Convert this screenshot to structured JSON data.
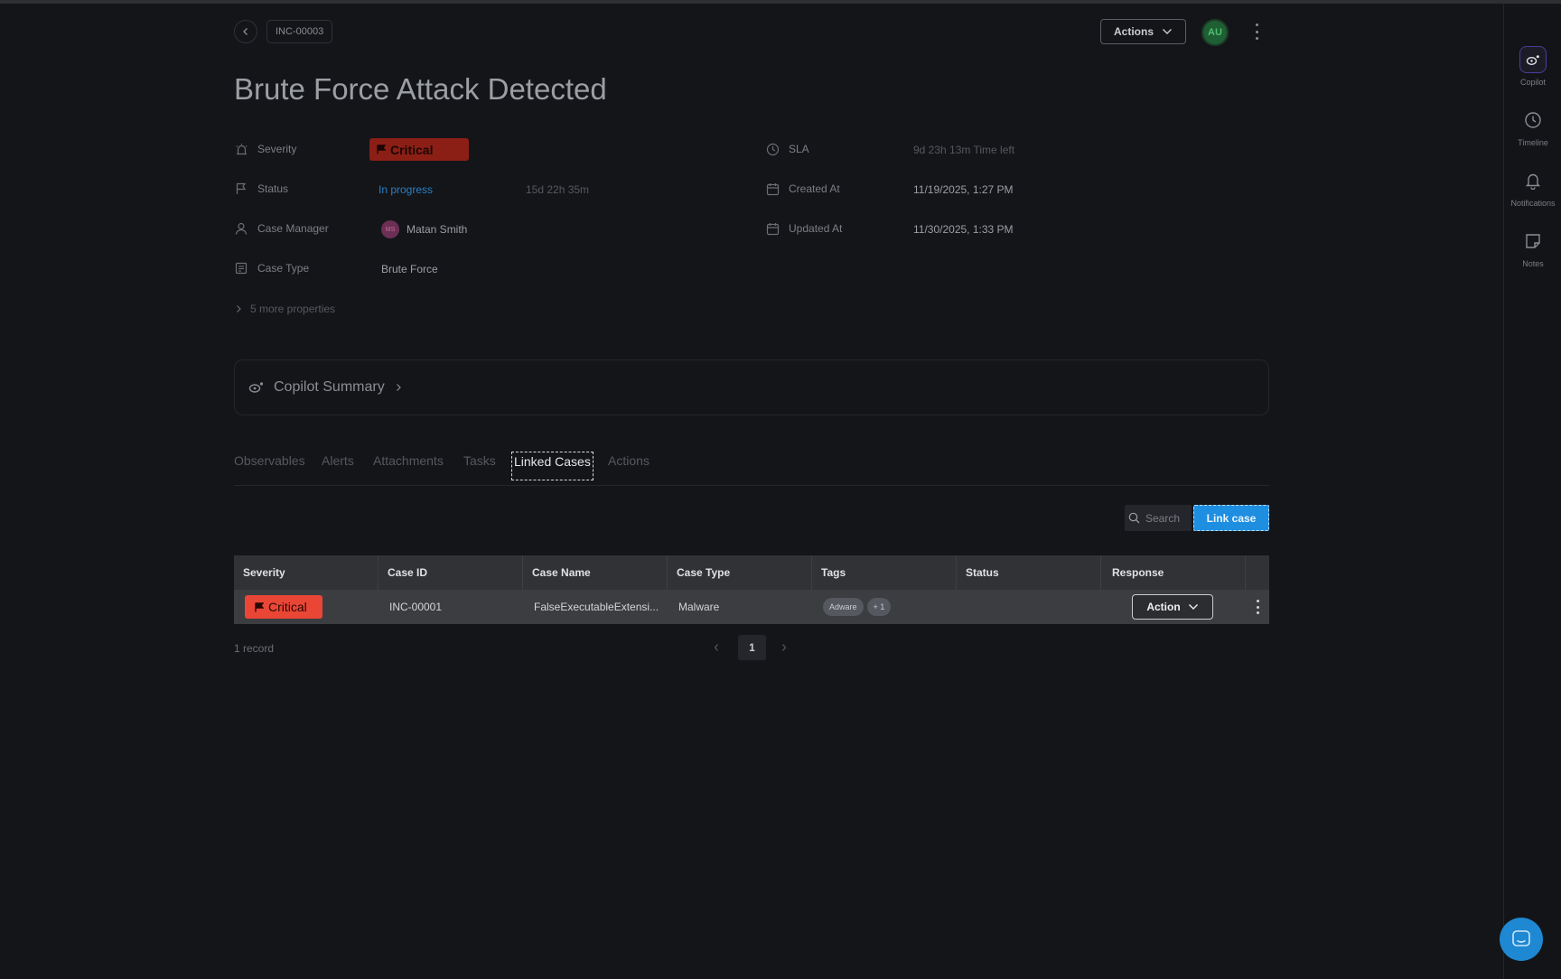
{
  "header": {
    "case_id": "INC-00003",
    "actions_label": "Actions",
    "user_initials": "AU",
    "title": "Brute Force Attack Detected"
  },
  "properties": {
    "severity_label": "Severity",
    "severity_value": "Critical",
    "status_label": "Status",
    "status_value": "In progress",
    "status_duration": "15d 22h 35m",
    "manager_label": "Case Manager",
    "manager_initials": "MS",
    "manager_name": "Matan Smith",
    "type_label": "Case Type",
    "type_value": "Brute Force",
    "more_label": "5 more properties",
    "sla_label": "SLA",
    "sla_value": "9d 23h 13m  Time left",
    "created_label": "Created At",
    "created_value": "11/19/2025, 1:27 PM",
    "updated_label": "Updated At",
    "updated_value": "11/30/2025, 1:33 PM"
  },
  "copilot_summary": {
    "title": "Copilot Summary"
  },
  "tabs": [
    {
      "label": "Observables",
      "active": false
    },
    {
      "label": "Alerts",
      "active": false
    },
    {
      "label": "Attachments",
      "active": false
    },
    {
      "label": "Tasks",
      "active": false
    },
    {
      "label": "Linked Cases",
      "active": true
    },
    {
      "label": "Actions",
      "active": false
    }
  ],
  "toolbar": {
    "search_placeholder": "Search",
    "link_case_label": "Link case"
  },
  "table": {
    "columns": [
      "Severity",
      "Case ID",
      "Case Name",
      "Case Type",
      "Tags",
      "Status",
      "Response",
      ""
    ],
    "rows": [
      {
        "severity": "Critical",
        "case_id": "INC-00001",
        "case_name": "FalseExecutableExtensi...",
        "case_type": "Malware",
        "tags": [
          "Adware",
          "+ 1"
        ],
        "status": "",
        "response": "Action"
      }
    ]
  },
  "footer": {
    "records": "1 record",
    "current_page": "1"
  },
  "rail": [
    {
      "label": "Copilot",
      "icon": "copilot-icon",
      "active": true
    },
    {
      "label": "Timeline",
      "icon": "clock-icon",
      "active": false
    },
    {
      "label": "Notifications",
      "icon": "bell-icon",
      "active": false
    },
    {
      "label": "Notes",
      "icon": "note-icon",
      "active": false
    }
  ],
  "colors": {
    "critical": "#ea4636",
    "link_button": "#1e8ee0",
    "status_link": "#2b7fc4",
    "background": "#141519"
  }
}
